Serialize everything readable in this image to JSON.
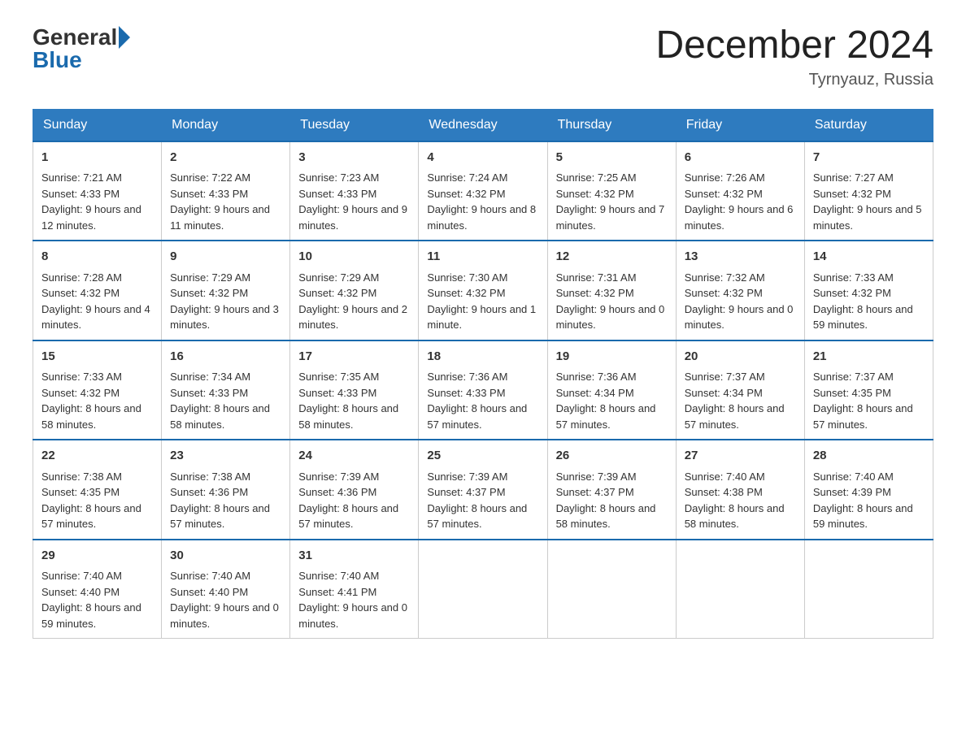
{
  "logo": {
    "general": "General",
    "blue": "Blue"
  },
  "header": {
    "month": "December 2024",
    "location": "Tyrnyauz, Russia"
  },
  "weekdays": [
    "Sunday",
    "Monday",
    "Tuesday",
    "Wednesday",
    "Thursday",
    "Friday",
    "Saturday"
  ],
  "weeks": [
    [
      {
        "day": "1",
        "sunrise": "7:21 AM",
        "sunset": "4:33 PM",
        "daylight": "9 hours and 12 minutes."
      },
      {
        "day": "2",
        "sunrise": "7:22 AM",
        "sunset": "4:33 PM",
        "daylight": "9 hours and 11 minutes."
      },
      {
        "day": "3",
        "sunrise": "7:23 AM",
        "sunset": "4:33 PM",
        "daylight": "9 hours and 9 minutes."
      },
      {
        "day": "4",
        "sunrise": "7:24 AM",
        "sunset": "4:32 PM",
        "daylight": "9 hours and 8 minutes."
      },
      {
        "day": "5",
        "sunrise": "7:25 AM",
        "sunset": "4:32 PM",
        "daylight": "9 hours and 7 minutes."
      },
      {
        "day": "6",
        "sunrise": "7:26 AM",
        "sunset": "4:32 PM",
        "daylight": "9 hours and 6 minutes."
      },
      {
        "day": "7",
        "sunrise": "7:27 AM",
        "sunset": "4:32 PM",
        "daylight": "9 hours and 5 minutes."
      }
    ],
    [
      {
        "day": "8",
        "sunrise": "7:28 AM",
        "sunset": "4:32 PM",
        "daylight": "9 hours and 4 minutes."
      },
      {
        "day": "9",
        "sunrise": "7:29 AM",
        "sunset": "4:32 PM",
        "daylight": "9 hours and 3 minutes."
      },
      {
        "day": "10",
        "sunrise": "7:29 AM",
        "sunset": "4:32 PM",
        "daylight": "9 hours and 2 minutes."
      },
      {
        "day": "11",
        "sunrise": "7:30 AM",
        "sunset": "4:32 PM",
        "daylight": "9 hours and 1 minute."
      },
      {
        "day": "12",
        "sunrise": "7:31 AM",
        "sunset": "4:32 PM",
        "daylight": "9 hours and 0 minutes."
      },
      {
        "day": "13",
        "sunrise": "7:32 AM",
        "sunset": "4:32 PM",
        "daylight": "9 hours and 0 minutes."
      },
      {
        "day": "14",
        "sunrise": "7:33 AM",
        "sunset": "4:32 PM",
        "daylight": "8 hours and 59 minutes."
      }
    ],
    [
      {
        "day": "15",
        "sunrise": "7:33 AM",
        "sunset": "4:32 PM",
        "daylight": "8 hours and 58 minutes."
      },
      {
        "day": "16",
        "sunrise": "7:34 AM",
        "sunset": "4:33 PM",
        "daylight": "8 hours and 58 minutes."
      },
      {
        "day": "17",
        "sunrise": "7:35 AM",
        "sunset": "4:33 PM",
        "daylight": "8 hours and 58 minutes."
      },
      {
        "day": "18",
        "sunrise": "7:36 AM",
        "sunset": "4:33 PM",
        "daylight": "8 hours and 57 minutes."
      },
      {
        "day": "19",
        "sunrise": "7:36 AM",
        "sunset": "4:34 PM",
        "daylight": "8 hours and 57 minutes."
      },
      {
        "day": "20",
        "sunrise": "7:37 AM",
        "sunset": "4:34 PM",
        "daylight": "8 hours and 57 minutes."
      },
      {
        "day": "21",
        "sunrise": "7:37 AM",
        "sunset": "4:35 PM",
        "daylight": "8 hours and 57 minutes."
      }
    ],
    [
      {
        "day": "22",
        "sunrise": "7:38 AM",
        "sunset": "4:35 PM",
        "daylight": "8 hours and 57 minutes."
      },
      {
        "day": "23",
        "sunrise": "7:38 AM",
        "sunset": "4:36 PM",
        "daylight": "8 hours and 57 minutes."
      },
      {
        "day": "24",
        "sunrise": "7:39 AM",
        "sunset": "4:36 PM",
        "daylight": "8 hours and 57 minutes."
      },
      {
        "day": "25",
        "sunrise": "7:39 AM",
        "sunset": "4:37 PM",
        "daylight": "8 hours and 57 minutes."
      },
      {
        "day": "26",
        "sunrise": "7:39 AM",
        "sunset": "4:37 PM",
        "daylight": "8 hours and 58 minutes."
      },
      {
        "day": "27",
        "sunrise": "7:40 AM",
        "sunset": "4:38 PM",
        "daylight": "8 hours and 58 minutes."
      },
      {
        "day": "28",
        "sunrise": "7:40 AM",
        "sunset": "4:39 PM",
        "daylight": "8 hours and 59 minutes."
      }
    ],
    [
      {
        "day": "29",
        "sunrise": "7:40 AM",
        "sunset": "4:40 PM",
        "daylight": "8 hours and 59 minutes."
      },
      {
        "day": "30",
        "sunrise": "7:40 AM",
        "sunset": "4:40 PM",
        "daylight": "9 hours and 0 minutes."
      },
      {
        "day": "31",
        "sunrise": "7:40 AM",
        "sunset": "4:41 PM",
        "daylight": "9 hours and 0 minutes."
      },
      null,
      null,
      null,
      null
    ]
  ],
  "labels": {
    "sunrise": "Sunrise:",
    "sunset": "Sunset:",
    "daylight": "Daylight:"
  }
}
